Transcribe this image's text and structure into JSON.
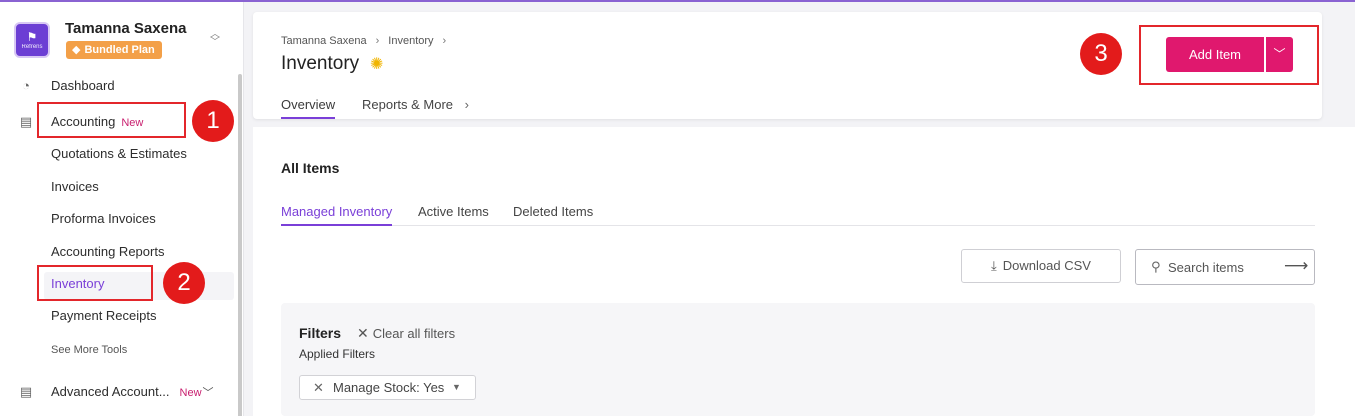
{
  "profile": {
    "name": "Tamanna Saxena",
    "plan": "Bundled Plan",
    "logo_text": "Refrens"
  },
  "sidebar": {
    "dashboard": "Dashboard",
    "accounting": "Accounting",
    "accounting_badge": "New",
    "sub_items": [
      "Quotations & Estimates",
      "Invoices",
      "Proforma Invoices",
      "Accounting Reports",
      "Inventory",
      "Payment Receipts"
    ],
    "see_more": "See More Tools",
    "advanced": "Advanced Account...",
    "advanced_badge": "New"
  },
  "annotations": {
    "m1": "1",
    "m2": "2",
    "m3": "3"
  },
  "header": {
    "breadcrumb": [
      "Tamanna Saxena",
      "Inventory"
    ],
    "title": "Inventory",
    "tabs": [
      "Overview",
      "Reports & More"
    ],
    "add_button": "Add Item"
  },
  "main": {
    "section_title": "All Items",
    "tabs": [
      "Managed Inventory",
      "Active Items",
      "Deleted Items"
    ],
    "download_button": "Download CSV",
    "search_placeholder": "Search items",
    "filters": {
      "title": "Filters",
      "clear_all": "Clear all filters",
      "applied_label": "Applied Filters",
      "chip": "Manage Stock: Yes"
    }
  },
  "colors": {
    "accent": "#7a3fd8",
    "primary_button": "#e0186e",
    "annotation": "#e31b1b",
    "plan_badge": "#f3a048"
  }
}
